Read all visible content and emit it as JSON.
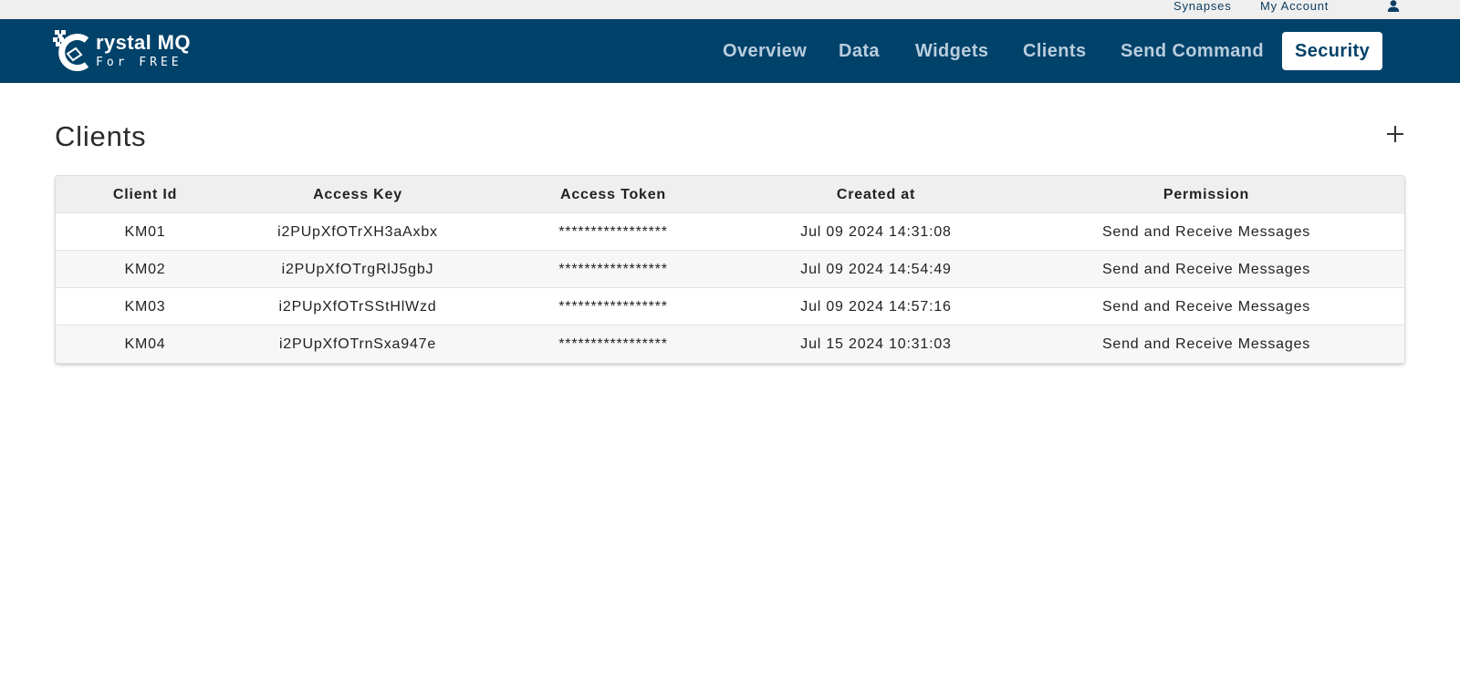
{
  "topbar": {
    "links": [
      "Synapses",
      "My Account"
    ],
    "user_icon": "user-icon"
  },
  "brand": {
    "name": "rystal MQ",
    "tagline": "For FREE",
    "logo_icon": "crystal-logo-icon"
  },
  "nav": {
    "items": [
      "Overview",
      "Data",
      "Widgets",
      "Clients",
      "Send Command",
      "Security"
    ],
    "active": "Security"
  },
  "page": {
    "title": "Clients",
    "add_icon": "plus-icon"
  },
  "table": {
    "columns": [
      "Client Id",
      "Access Key",
      "Access Token",
      "Created at",
      "Permission"
    ],
    "rows": [
      [
        "KM01",
        "i2PUpXfOTrXH3aAxbx",
        "*****************",
        "Jul 09 2024 14:31:08",
        "Send and Receive Messages"
      ],
      [
        "KM02",
        "i2PUpXfOTrgRlJ5gbJ",
        "*****************",
        "Jul 09 2024 14:54:49",
        "Send and Receive Messages"
      ],
      [
        "KM03",
        "i2PUpXfOTrSStHlWzd",
        "*****************",
        "Jul 09 2024 14:57:16",
        "Send and Receive Messages"
      ],
      [
        "KM04",
        "i2PUpXfOTrnSxa947e",
        "*****************",
        "Jul 15 2024 10:31:03",
        "Send and Receive Messages"
      ]
    ]
  },
  "colors": {
    "navbar": "#01426a",
    "nav_text": "#b9cddd",
    "topbar": "#efefef"
  }
}
